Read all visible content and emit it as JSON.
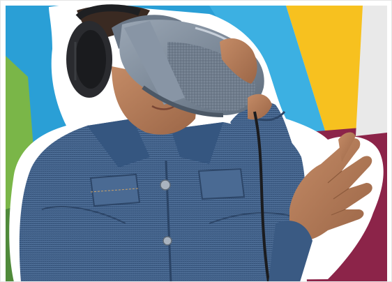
{
  "image": {
    "description_colors": {
      "stripe_blue": "#2a9fd6",
      "stripe_green": "#7ab648",
      "stripe_yellow": "#f7c11f",
      "stripe_maroon": "#8c2449",
      "jacket_denim": "#3d5a80",
      "headset_gray": "#7a8797",
      "skin": "#b07a5a",
      "outline_white": "#ffffff"
    },
    "icons": [
      "vr-headset",
      "headphones"
    ]
  }
}
